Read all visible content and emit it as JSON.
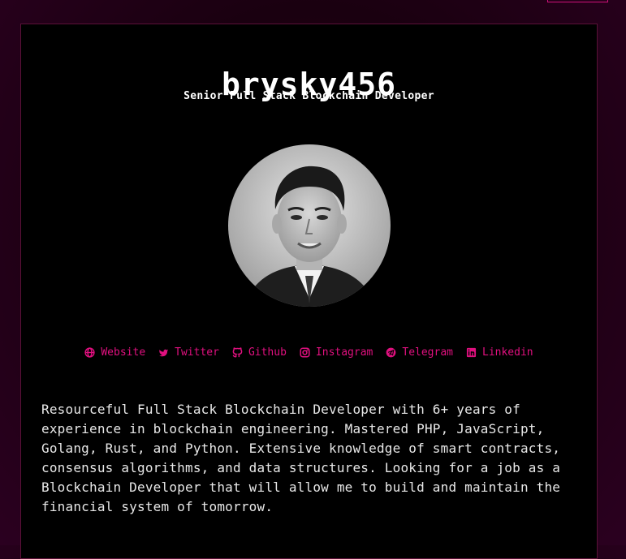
{
  "profile": {
    "name": "brysky456",
    "headline": "Senior Full Stack Blockchain Developer",
    "bio": "Resourceful Full Stack Blockchain Developer with 6+ years of experience in blockchain engineering. Mastered PHP, JavaScript, Golang, Rust, and Python. Extensive knowledge of smart contracts, consensus algorithms, and data structures. Looking for a job as a Blockchain Developer that will allow me to build and maintain the financial system of tomorrow."
  },
  "links": [
    {
      "label": "Website",
      "icon": "globe-icon"
    },
    {
      "label": "Twitter",
      "icon": "twitter-icon"
    },
    {
      "label": "Github",
      "icon": "github-icon"
    },
    {
      "label": "Instagram",
      "icon": "instagram-icon"
    },
    {
      "label": "Telegram",
      "icon": "telegram-icon"
    },
    {
      "label": "Linkedin",
      "icon": "linkedin-icon"
    }
  ],
  "colors": {
    "accent": "#e0107f",
    "card_bg": "#000000",
    "page_bg": "#1a0010"
  }
}
